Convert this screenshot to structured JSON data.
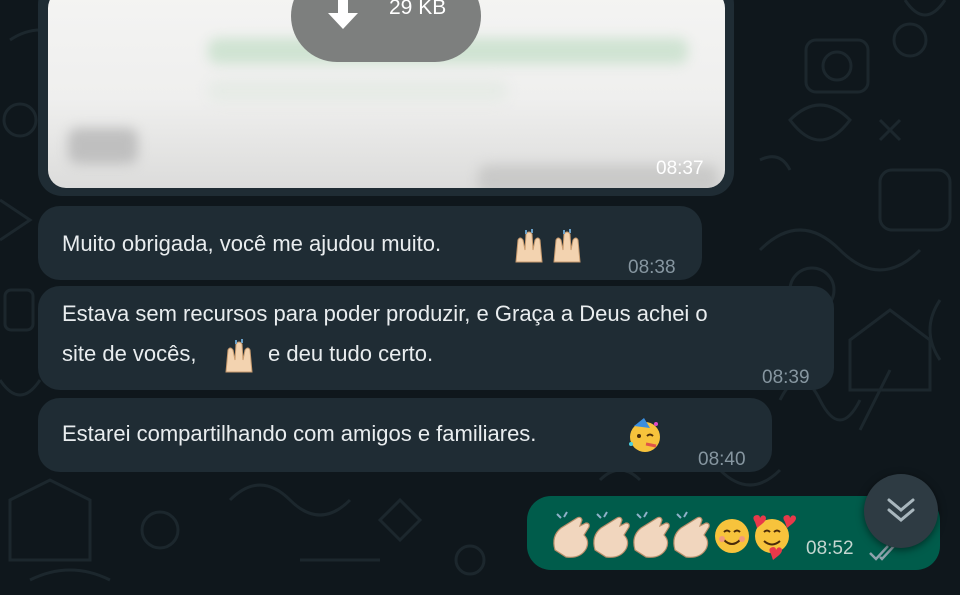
{
  "colors": {
    "background": "#0f171c",
    "incoming_bubble": "#1f2c34",
    "outgoing_bubble": "#005c4b",
    "timestamp": "#8696a0",
    "read_ticks": "#8fa3ad",
    "scroll_button": "#2e3b43"
  },
  "attachment": {
    "size_label": "29 KB",
    "time": "08:37",
    "icon": "download-arrow-icon"
  },
  "messages": [
    {
      "text": "Muito obrigada, você me ajudou muito.",
      "emoji": "raised-hands x2",
      "time": "08:38"
    },
    {
      "text_line1": "Estava sem recursos para poder produzir, e Graça a Deus achei o",
      "text_line2_a": "site de vocês,",
      "emoji": "raised-hands",
      "text_line2_b": "e deu tudo certo.",
      "time": "08:39"
    },
    {
      "text": "Estarei compartilhando com amigos e familiares.",
      "emoji": "partying-face",
      "time": "08:40"
    }
  ],
  "outgoing": {
    "emoji": [
      "clapping-hands",
      "clapping-hands",
      "clapping-hands",
      "clapping-hands",
      "smiling-face",
      "smiling-face-with-hearts"
    ],
    "time": "08:52",
    "status_icon": "double-check-icon"
  },
  "scroll_button": {
    "icon": "double-chevron-down-icon"
  }
}
